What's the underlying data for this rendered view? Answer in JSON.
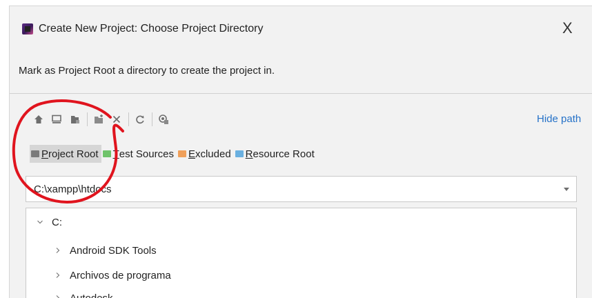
{
  "dialog": {
    "title": "Create New Project: Choose Project Directory",
    "close_symbol": "X",
    "subtitle": "Mark as Project Root a directory to create the project in.",
    "app_icon": "phpstorm-app-icon"
  },
  "toolbar": {
    "buttons": [
      {
        "icon": "home-icon"
      },
      {
        "icon": "desktop-icon"
      },
      {
        "icon": "project-folder-icon"
      },
      {
        "icon": "new-folder-icon"
      },
      {
        "icon": "delete-icon"
      },
      {
        "icon": "refresh-icon"
      },
      {
        "icon": "show-hidden-icon"
      }
    ],
    "hide_path": "Hide path"
  },
  "marks": [
    {
      "mnemonic": "P",
      "rest": "roject Root",
      "color": "#7b7b7b",
      "active": true
    },
    {
      "mnemonic": "T",
      "rest": "est Sources",
      "color": "#6fc36a",
      "active": false
    },
    {
      "mnemonic": "E",
      "rest": "xcluded",
      "color": "#f0a05a",
      "active": false
    },
    {
      "mnemonic": "R",
      "rest": "esource Root",
      "color": "#6ab0e0",
      "active": false
    }
  ],
  "path": {
    "value": "C:\\xampp\\htdocs"
  },
  "tree": {
    "root": {
      "label": "C:",
      "expanded": true
    },
    "children": [
      {
        "label": "Android SDK Tools"
      },
      {
        "label": "Archivos de programa"
      },
      {
        "label": "Autodesk"
      }
    ]
  },
  "annotation": {
    "color": "#e0141e",
    "shape": "hand-drawn circle"
  }
}
